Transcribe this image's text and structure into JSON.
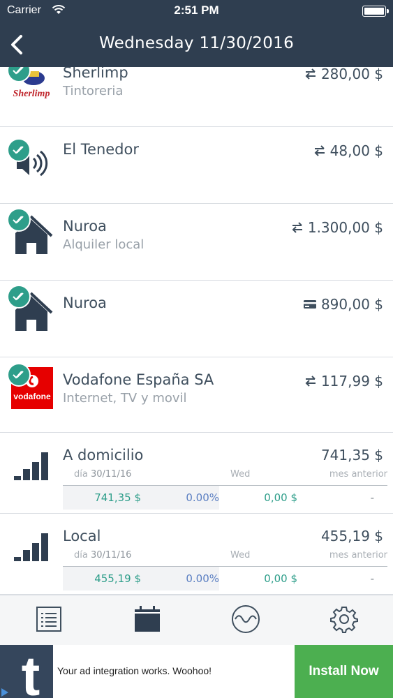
{
  "status_bar": {
    "carrier": "Carrier",
    "time": "2:51 PM"
  },
  "nav": {
    "title": "Wednesday 11/30/2016"
  },
  "transactions": [
    {
      "name": "Sherlimp",
      "subtitle": "Tintoreria",
      "amount": "280,00 $",
      "method_icon": "transfer-icon",
      "logo": "Sherlimp"
    },
    {
      "name": "El Tenedor",
      "subtitle": "",
      "amount": "48,00 $",
      "method_icon": "transfer-icon"
    },
    {
      "name": "Nuroa",
      "subtitle": "Alquiler local",
      "amount": "1.300,00 $",
      "method_icon": "transfer-icon"
    },
    {
      "name": "Nuroa",
      "subtitle": "",
      "amount": "890,00 $",
      "method_icon": "card-icon"
    },
    {
      "name": "Vodafone España SA",
      "subtitle": "Internet, TV y movil",
      "amount": "117,99 $",
      "method_icon": "transfer-icon",
      "logo": "vodafone"
    }
  ],
  "summaries": [
    {
      "name": "A domicilio",
      "total": "741,35 $",
      "date_label": "día",
      "date": "30/11/16",
      "day_label": "Wed",
      "prev_label": "mes anterior",
      "values": [
        "741,35 $",
        "0.00%",
        "0,00 $",
        "-"
      ]
    },
    {
      "name": "Local",
      "total": "455,19 $",
      "date_label": "día",
      "date": "30/11/16",
      "day_label": "Wed",
      "prev_label": "mes anterior",
      "values": [
        "455,19 $",
        "0.00%",
        "0,00 $",
        "-"
      ]
    }
  ],
  "tabs": [
    "list-icon",
    "calendar-icon",
    "chart-wave-icon",
    "settings-gear-icon"
  ],
  "ad": {
    "text": "Your ad integration works. Woohoo!",
    "button": "Install Now",
    "logo_letter": "t"
  },
  "colors": {
    "nav": "#2f3e50",
    "accent": "#2e9e8a",
    "percent": "#5b7fc2",
    "install": "#4caf50"
  }
}
